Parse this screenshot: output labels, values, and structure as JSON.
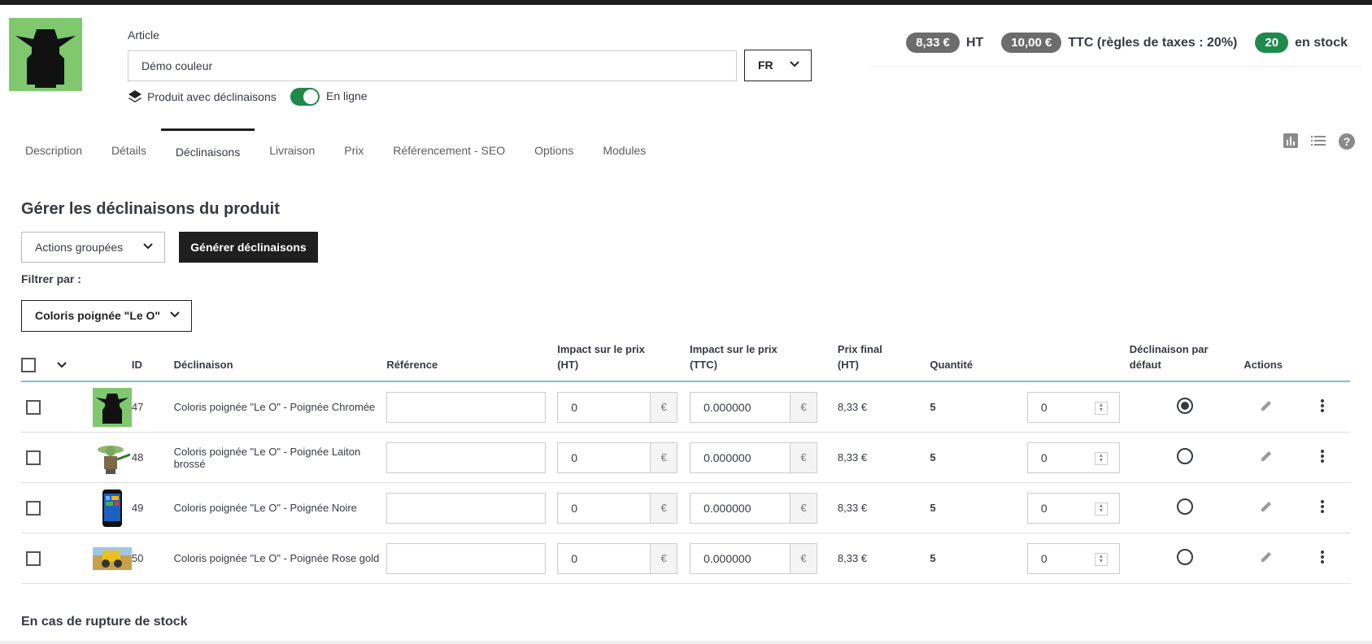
{
  "header": {
    "article_label": "Article",
    "product_name": "Démo couleur",
    "language": "FR",
    "product_type": "Produit avec déclinaisons",
    "online_label": "En ligne",
    "online": true,
    "price_ht": "8,33 €",
    "ht_label": "HT",
    "price_ttc": "10,00 €",
    "ttc_label": "TTC (règles de taxes : 20%)",
    "stock": "20",
    "stock_label": "en stock"
  },
  "tabs": [
    "Description",
    "Détails",
    "Déclinaisons",
    "Livraison",
    "Prix",
    "Référencement - SEO",
    "Options",
    "Modules"
  ],
  "active_tab": "Déclinaisons",
  "section": {
    "title": "Gérer les déclinaisons du produit",
    "bulk_actions": "Actions groupées",
    "generate": "Générer déclinaisons",
    "filter_label": "Filtrer par :",
    "filter_value": "Coloris poignée \"Le O\""
  },
  "table": {
    "headers": {
      "id": "ID",
      "combination": "Déclinaison",
      "reference": "Référence",
      "impact_ht_1": "Impact sur le prix",
      "impact_ht_2": "(HT)",
      "impact_ttc_1": "Impact sur le prix",
      "impact_ttc_2": "(TTC)",
      "final_1": "Prix final",
      "final_2": "(HT)",
      "quantity": "Quantité",
      "default_1": "Déclinaison par",
      "default_2": "défaut",
      "actions": "Actions"
    },
    "rows": [
      {
        "id": "47",
        "name": "Coloris poignée \"Le O\" - Poignée Chromée",
        "impact_ht": "0",
        "currency": "€",
        "impact_ttc": "0.000000",
        "final": "8,33 €",
        "quantity": "5",
        "qty_input": "0",
        "default": true,
        "img": "yoda-silhouette"
      },
      {
        "id": "48",
        "name": "Coloris poignée \"Le O\" - Poignée Laiton brossé",
        "impact_ht": "0",
        "currency": "€",
        "impact_ttc": "0.000000",
        "final": "8,33 €",
        "quantity": "5",
        "qty_input": "0",
        "default": false,
        "img": "yoda-figure"
      },
      {
        "id": "49",
        "name": "Coloris poignée \"Le O\" - Poignée Noire",
        "impact_ht": "0",
        "currency": "€",
        "impact_ttc": "0.000000",
        "final": "8,33 €",
        "quantity": "5",
        "qty_input": "0",
        "default": false,
        "img": "phone"
      },
      {
        "id": "50",
        "name": "Coloris poignée \"Le O\" - Poignée Rose gold",
        "impact_ht": "0",
        "currency": "€",
        "impact_ttc": "0.000000",
        "final": "8,33 €",
        "quantity": "5",
        "qty_input": "0",
        "default": false,
        "img": "harvester"
      }
    ]
  },
  "bottom_title": "En cas de rupture de stock",
  "colors": {
    "accent_green": "#1e8a4c",
    "pill_gray": "#6c6c6c",
    "dark": "#1f1f1f",
    "table_border": "#7cc1c9"
  }
}
